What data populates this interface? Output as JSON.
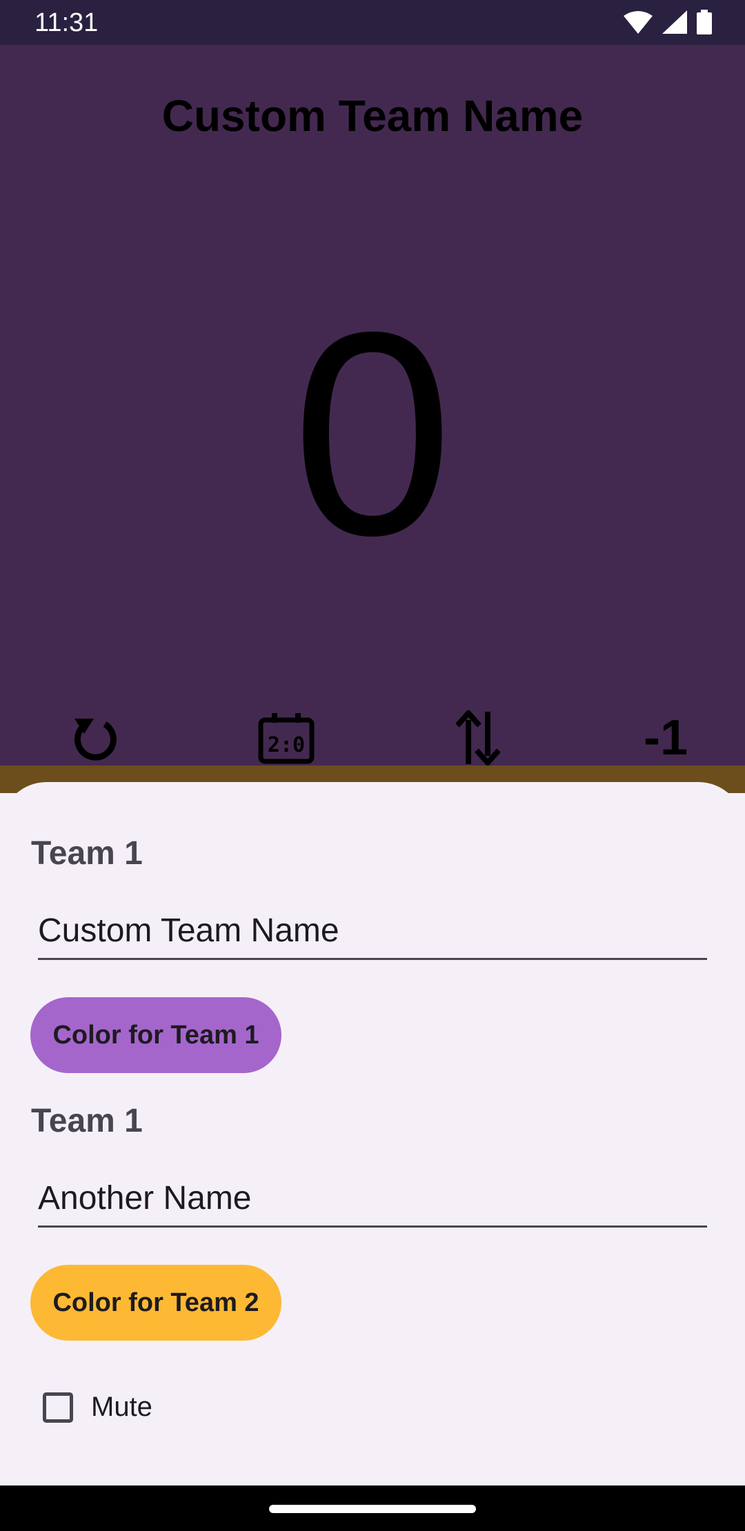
{
  "status": {
    "time": "11:31"
  },
  "scoreboard": {
    "team_name": "Custom Team Name",
    "score": "0",
    "minus_label": "-1"
  },
  "sheet": {
    "team1": {
      "label": "Team 1",
      "name_value": "Custom Team Name",
      "color_button": "Color for Team 1",
      "color": "#a566cc"
    },
    "team2": {
      "label": "Team 1",
      "name_value": "Another Name",
      "color_button": "Color for Team 2",
      "color": "#fdb934"
    },
    "mute_label": "Mute",
    "mute_checked": false
  },
  "colors": {
    "scoreboard_bg": "#432950",
    "status_bar_bg": "#2a2140",
    "sheet_bg": "#f5f0f8"
  },
  "icons": [
    "wifi-icon",
    "cellular-signal-icon",
    "battery-icon",
    "reset-icon",
    "scoreboard-icon",
    "swap-icon"
  ]
}
